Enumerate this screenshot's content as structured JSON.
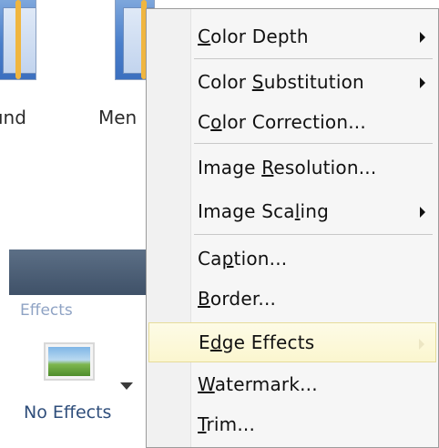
{
  "ribbon": {
    "thumb_labels": [
      "ınd",
      "Men"
    ],
    "effects_label": "Effects",
    "no_effects_label": "No Effects"
  },
  "menu": {
    "items": [
      {
        "pre": "",
        "u": "C",
        "post": "olor Depth",
        "has_submenu": true,
        "highlighted": false
      },
      {
        "pre": "Color ",
        "u": "S",
        "post": "ubstitution",
        "has_submenu": true,
        "highlighted": false
      },
      {
        "pre": "C",
        "u": "o",
        "post": "lor Correction...",
        "has_submenu": false,
        "highlighted": false
      },
      {
        "pre": "Image ",
        "u": "R",
        "post": "esolution...",
        "has_submenu": false,
        "highlighted": false
      },
      {
        "pre": "Image Sca",
        "u": "l",
        "post": "ing",
        "has_submenu": true,
        "highlighted": false
      },
      {
        "pre": "Ca",
        "u": "p",
        "post": "tion...",
        "has_submenu": false,
        "highlighted": false
      },
      {
        "pre": "",
        "u": "B",
        "post": "order...",
        "has_submenu": false,
        "highlighted": false
      },
      {
        "pre": "E",
        "u": "d",
        "post": "ge Effects",
        "has_submenu": true,
        "highlighted": true
      },
      {
        "pre": "",
        "u": "W",
        "post": "atermark...",
        "has_submenu": false,
        "highlighted": false
      },
      {
        "pre": "",
        "u": "T",
        "post": "rim...",
        "has_submenu": false,
        "highlighted": false
      }
    ]
  }
}
